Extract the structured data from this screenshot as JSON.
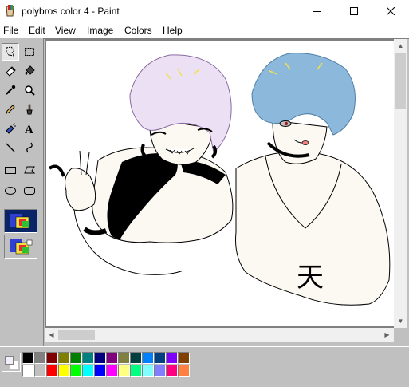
{
  "window": {
    "title": "polybros color 4 - Paint",
    "app_icon": "paint-bucket-icon",
    "controls": [
      "minimize-icon",
      "maximize-icon",
      "close-icon"
    ]
  },
  "menu": {
    "items": [
      "File",
      "Edit",
      "View",
      "Image",
      "Colors",
      "Help"
    ]
  },
  "toolbox": {
    "tools": [
      {
        "name": "free-form-select",
        "icon": "free-form-select-icon",
        "selected": true
      },
      {
        "name": "select",
        "icon": "rectangle-select-icon",
        "selected": false
      },
      {
        "name": "eraser",
        "icon": "eraser-icon",
        "selected": false
      },
      {
        "name": "fill",
        "icon": "paint-bucket-icon",
        "selected": false
      },
      {
        "name": "pick-color",
        "icon": "eyedropper-icon",
        "selected": false
      },
      {
        "name": "magnifier",
        "icon": "magnifier-icon",
        "selected": false
      },
      {
        "name": "pencil",
        "icon": "pencil-icon",
        "selected": false
      },
      {
        "name": "brush",
        "icon": "brush-icon",
        "selected": false
      },
      {
        "name": "airbrush",
        "icon": "airbrush-icon",
        "selected": false
      },
      {
        "name": "text",
        "icon": "text-icon",
        "selected": false
      },
      {
        "name": "line",
        "icon": "line-icon",
        "selected": false
      },
      {
        "name": "curve",
        "icon": "curve-icon",
        "selected": false
      },
      {
        "name": "rectangle",
        "icon": "rectangle-icon",
        "selected": false
      },
      {
        "name": "polygon",
        "icon": "polygon-icon",
        "selected": false
      },
      {
        "name": "ellipse",
        "icon": "ellipse-icon",
        "selected": false
      },
      {
        "name": "rounded-rectangle",
        "icon": "rounded-rectangle-icon",
        "selected": false
      }
    ],
    "options": [
      {
        "name": "opaque-selection",
        "icon": "opaque-selection-icon",
        "active": true
      },
      {
        "name": "transparent-selection",
        "icon": "transparent-selection-icon",
        "active": false
      }
    ]
  },
  "colors": {
    "foreground": "#f4eefa",
    "background": "#ffffff",
    "palette_top": [
      "#000000",
      "#808080",
      "#800000",
      "#808000",
      "#008000",
      "#008080",
      "#000080",
      "#800080",
      "#808040",
      "#004040",
      "#0080ff",
      "#004080",
      "#8000ff",
      "#804000"
    ],
    "palette_bottom": [
      "#ffffff",
      "#c0c0c0",
      "#ff0000",
      "#ffff00",
      "#00ff00",
      "#00ffff",
      "#0000ff",
      "#ff00ff",
      "#ffff80",
      "#00ff80",
      "#80ffff",
      "#8080ff",
      "#ff0080",
      "#ff8040"
    ]
  },
  "canvas": {
    "drawing": "two-anime-characters-sketch",
    "glyph": "天"
  }
}
